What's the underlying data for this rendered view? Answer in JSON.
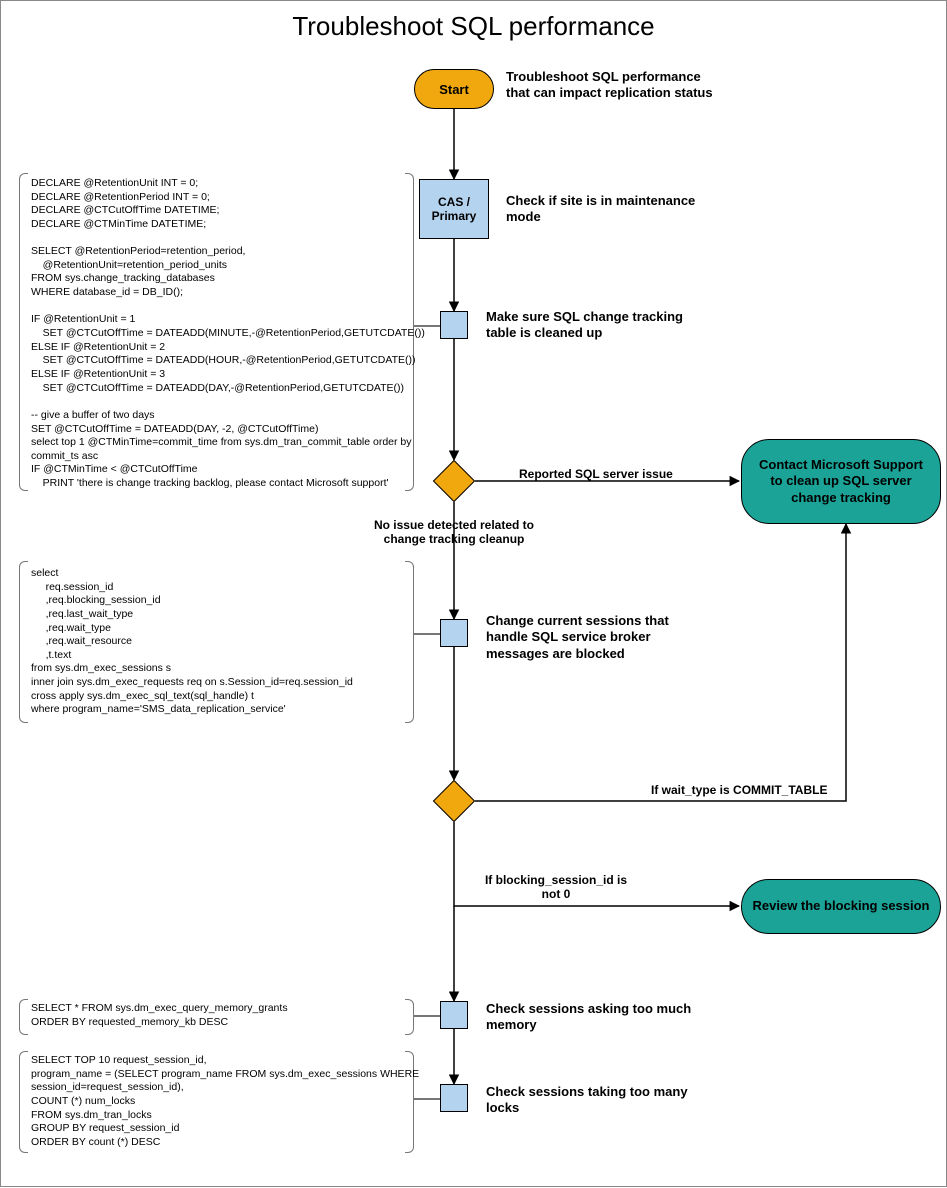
{
  "title": "Troubleshoot SQL performance",
  "start": {
    "label": "Start",
    "annotation": "Troubleshoot SQL performance that can impact replication status"
  },
  "steps": {
    "cas_primary": {
      "label": "CAS /\nPrimary",
      "annotation": "Check if site is in maintenance mode"
    },
    "cleanup_ct": {
      "annotation": "Make sure SQL change tracking table is cleaned up"
    },
    "sessions_blocked": {
      "annotation": "Change current sessions that handle SQL service broker messages are blocked"
    },
    "check_memory": {
      "annotation": "Check sessions asking too much memory"
    },
    "check_locks": {
      "annotation": "Check sessions taking too many locks"
    }
  },
  "decisions": {
    "d1_right": "Reported SQL server issue",
    "d1_down": "No issue detected related to change tracking cleanup",
    "d2_right": "If wait_type is COMMIT_TABLE",
    "d2_down": "If blocking_session_id is not 0"
  },
  "terminals": {
    "contact_support": "Contact Microsoft Support to clean up SQL server change tracking",
    "review_blocking": "Review the blocking session"
  },
  "code": {
    "block1": "DECLARE @RetentionUnit INT = 0;\nDECLARE @RetentionPeriod INT = 0;\nDECLARE @CTCutOffTime DATETIME;\nDECLARE @CTMinTime DATETIME;\n\nSELECT @RetentionPeriod=retention_period,\n    @RetentionUnit=retention_period_units\nFROM sys.change_tracking_databases\nWHERE database_id = DB_ID();\n\nIF @RetentionUnit = 1\n    SET @CTCutOffTime = DATEADD(MINUTE,-@RetentionPeriod,GETUTCDATE())\nELSE IF @RetentionUnit = 2\n    SET @CTCutOffTime = DATEADD(HOUR,-@RetentionPeriod,GETUTCDATE())\nELSE IF @RetentionUnit = 3\n    SET @CTCutOffTime = DATEADD(DAY,-@RetentionPeriod,GETUTCDATE())\n\n-- give a buffer of two days\nSET @CTCutOffTime = DATEADD(DAY, -2, @CTCutOffTime)\nselect top 1 @CTMinTime=commit_time from sys.dm_tran_commit_table order by\ncommit_ts asc\nIF @CTMinTime < @CTCutOffTime\n    PRINT 'there is change tracking backlog, please contact Microsoft support'",
    "block2": "select\n     req.session_id\n     ,req.blocking_session_id\n     ,req.last_wait_type\n     ,req.wait_type\n     ,req.wait_resource\n     ,t.text\nfrom sys.dm_exec_sessions s\ninner join sys.dm_exec_requests req on s.Session_id=req.session_id\ncross apply sys.dm_exec_sql_text(sql_handle) t\nwhere program_name='SMS_data_replication_service'",
    "block3": "SELECT * FROM sys.dm_exec_query_memory_grants\nORDER BY requested_memory_kb DESC",
    "block4": "SELECT TOP 10 request_session_id,\nprogram_name = (SELECT program_name FROM sys.dm_exec_sessions WHERE\nsession_id=request_session_id),\nCOUNT (*) num_locks\nFROM sys.dm_tran_locks\nGROUP BY request_session_id\nORDER BY count (*) DESC"
  }
}
